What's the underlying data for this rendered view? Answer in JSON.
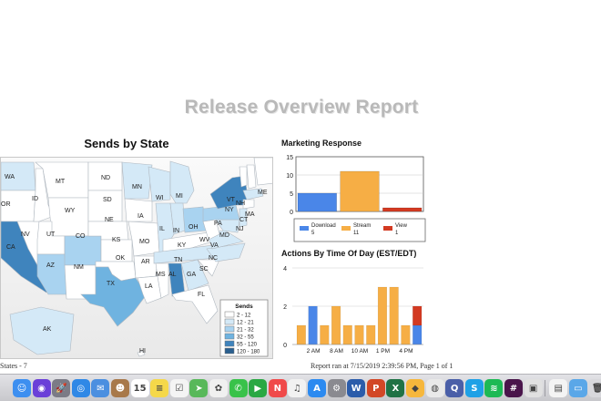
{
  "report": {
    "title": "Release Overview Report"
  },
  "map": {
    "title": "Sends by State",
    "legend_title": "Sends",
    "legend": [
      {
        "label": "2 - 12",
        "color": "#ffffff"
      },
      {
        "label": "12 - 21",
        "color": "#d4e9f7"
      },
      {
        "label": "21 - 32",
        "color": "#a9d3f0"
      },
      {
        "label": "32 - 55",
        "color": "#6fb3e0"
      },
      {
        "label": "55 - 120",
        "color": "#3f84bd"
      },
      {
        "label": "120 - 180",
        "color": "#2a5f8f"
      }
    ],
    "states": [
      {
        "abbr": "WA",
        "bin": 1
      },
      {
        "abbr": "OR",
        "bin": 0
      },
      {
        "abbr": "CA",
        "bin": 4
      },
      {
        "abbr": "NV",
        "bin": 0
      },
      {
        "abbr": "ID",
        "bin": 0
      },
      {
        "abbr": "MT",
        "bin": 0
      },
      {
        "abbr": "WY",
        "bin": 0
      },
      {
        "abbr": "UT",
        "bin": 0
      },
      {
        "abbr": "AZ",
        "bin": 2
      },
      {
        "abbr": "CO",
        "bin": 2
      },
      {
        "abbr": "NM",
        "bin": 0
      },
      {
        "abbr": "ND",
        "bin": 0
      },
      {
        "abbr": "SD",
        "bin": 0
      },
      {
        "abbr": "NE",
        "bin": 0
      },
      {
        "abbr": "KS",
        "bin": 0
      },
      {
        "abbr": "OK",
        "bin": 0
      },
      {
        "abbr": "TX",
        "bin": 3
      },
      {
        "abbr": "MN",
        "bin": 1
      },
      {
        "abbr": "IA",
        "bin": 0
      },
      {
        "abbr": "MO",
        "bin": 0
      },
      {
        "abbr": "AR",
        "bin": 0
      },
      {
        "abbr": "LA",
        "bin": 0
      },
      {
        "abbr": "WI",
        "bin": 1
      },
      {
        "abbr": "IL",
        "bin": 1
      },
      {
        "abbr": "MI",
        "bin": 1
      },
      {
        "abbr": "IN",
        "bin": 1
      },
      {
        "abbr": "OH",
        "bin": 2
      },
      {
        "abbr": "KY",
        "bin": 0
      },
      {
        "abbr": "TN",
        "bin": 1
      },
      {
        "abbr": "MS",
        "bin": 0
      },
      {
        "abbr": "AL",
        "bin": 4
      },
      {
        "abbr": "GA",
        "bin": 1
      },
      {
        "abbr": "FL",
        "bin": 0
      },
      {
        "abbr": "SC",
        "bin": 0
      },
      {
        "abbr": "NC",
        "bin": 1
      },
      {
        "abbr": "VA",
        "bin": 1
      },
      {
        "abbr": "WV",
        "bin": 0
      },
      {
        "abbr": "MD",
        "bin": 1
      },
      {
        "abbr": "PA",
        "bin": 2
      },
      {
        "abbr": "NY",
        "bin": 4
      },
      {
        "abbr": "VT",
        "bin": 0
      },
      {
        "abbr": "NH",
        "bin": 0
      },
      {
        "abbr": "MA",
        "bin": 1
      },
      {
        "abbr": "CT",
        "bin": 0
      },
      {
        "abbr": "NJ",
        "bin": 1
      },
      {
        "abbr": "ME",
        "bin": 0
      },
      {
        "abbr": "AK",
        "bin": 1
      },
      {
        "abbr": "HI",
        "bin": 0
      }
    ]
  },
  "chart_data": [
    {
      "type": "bar",
      "title": "Marketing Response",
      "ylim": [
        0,
        15
      ],
      "yticks": [
        0,
        5,
        10,
        15
      ],
      "categories": [
        "Download",
        "Stream",
        "View"
      ],
      "values": [
        5,
        11,
        1
      ],
      "colors": [
        "#4a86e8",
        "#f6ae45",
        "#d33a22"
      ],
      "legend": [
        {
          "name": "Download",
          "value": "5",
          "color": "#4a86e8"
        },
        {
          "name": "Stream",
          "value": "11",
          "color": "#f6ae45"
        },
        {
          "name": "View",
          "value": "1",
          "color": "#d33a22"
        }
      ]
    },
    {
      "type": "bar",
      "title": "Actions By Time Of Day (EST/EDT)",
      "ylim": [
        0,
        4
      ],
      "yticks": [
        0,
        2,
        4
      ],
      "tick_labels": [
        "2 AM",
        "8 AM",
        "10 AM",
        "1 PM",
        "4 PM"
      ],
      "tick_indices": [
        1,
        3,
        5,
        7,
        9
      ],
      "series": [
        {
          "name": "Stream",
          "color": "#f6ae45",
          "values": [
            1,
            0,
            1,
            2,
            1,
            1,
            1,
            3,
            3,
            1,
            0
          ]
        },
        {
          "name": "Download",
          "color": "#4a86e8",
          "values": [
            0,
            2,
            0,
            0,
            0,
            0,
            0,
            0,
            0,
            0,
            1
          ]
        },
        {
          "name": "View",
          "color": "#d33a22",
          "values": [
            0,
            0,
            0,
            0,
            0,
            0,
            0,
            0,
            0,
            0,
            1
          ]
        }
      ]
    }
  ],
  "status": {
    "left": "States - 7",
    "right": "Report ran at 7/15/2019 2:39:56 PM,  Page 1 of 1"
  },
  "dock": {
    "icons": [
      {
        "name": "finder-icon",
        "color": "#3d8ff0",
        "glyph": "☺"
      },
      {
        "name": "siri-icon",
        "color": "#6a3fd8",
        "glyph": "◉"
      },
      {
        "name": "launchpad-icon",
        "color": "#7b7b86",
        "glyph": "🚀"
      },
      {
        "name": "safari-icon",
        "color": "#2f88e6",
        "glyph": "◎"
      },
      {
        "name": "mail-icon",
        "color": "#4b8fe0",
        "glyph": "✉"
      },
      {
        "name": "contacts-icon",
        "color": "#a8794a",
        "glyph": "☻"
      },
      {
        "name": "calendar-icon",
        "color": "#ffffff",
        "glyph": "15"
      },
      {
        "name": "notes-icon",
        "color": "#f5d84a",
        "glyph": "≡"
      },
      {
        "name": "reminders-icon",
        "color": "#f4f4f4",
        "glyph": "☑"
      },
      {
        "name": "maps-icon",
        "color": "#58b85a",
        "glyph": "➤"
      },
      {
        "name": "photos-icon",
        "color": "#f0f0f0",
        "glyph": "✿"
      },
      {
        "name": "messages-icon",
        "color": "#39c24a",
        "glyph": "✆"
      },
      {
        "name": "facetime-icon",
        "color": "#2aa843",
        "glyph": "▶"
      },
      {
        "name": "news-icon",
        "color": "#f04a4a",
        "glyph": "N"
      },
      {
        "name": "music-icon",
        "color": "#f2f2f2",
        "glyph": "♫"
      },
      {
        "name": "appstore-icon",
        "color": "#2c8af0",
        "glyph": "A"
      },
      {
        "name": "preferences-icon",
        "color": "#8a8a90",
        "glyph": "⚙"
      },
      {
        "name": "word-icon",
        "color": "#2b5caa",
        "glyph": "W"
      },
      {
        "name": "powerpoint-icon",
        "color": "#d24726",
        "glyph": "P"
      },
      {
        "name": "excel-icon",
        "color": "#207245",
        "glyph": "X"
      },
      {
        "name": "sketch-icon",
        "color": "#f6b73c",
        "glyph": "◆"
      },
      {
        "name": "chrome-icon",
        "color": "#e9e9e9",
        "glyph": "◍"
      },
      {
        "name": "quicktime-icon",
        "color": "#4a5fa8",
        "glyph": "Q"
      },
      {
        "name": "skype-icon",
        "color": "#1fa1e6",
        "glyph": "S"
      },
      {
        "name": "spotify-icon",
        "color": "#1db954",
        "glyph": "≋"
      },
      {
        "name": "slack-icon",
        "color": "#4a154b",
        "glyph": "#"
      },
      {
        "name": "preview-icon",
        "color": "#e0e0e0",
        "glyph": "▣"
      },
      {
        "name": "documents-icon",
        "color": "#f4f4f4",
        "glyph": "▤"
      },
      {
        "name": "folder-icon",
        "color": "#5aa7e8",
        "glyph": "▭"
      },
      {
        "name": "trash-icon",
        "color": "#d8d8dc",
        "glyph": "🗑"
      }
    ]
  }
}
